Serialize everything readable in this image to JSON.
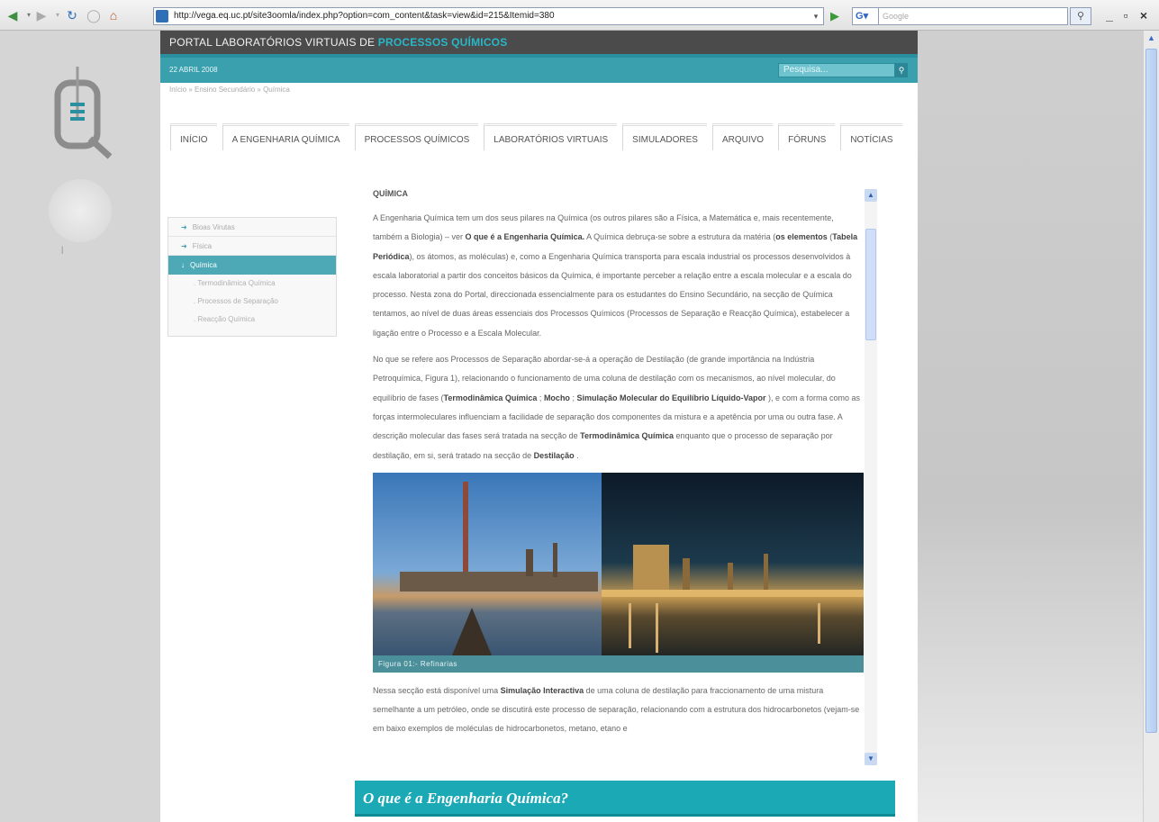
{
  "browser": {
    "url": "http://vega.eq.uc.pt/site3oomla/index.php?option=com_content&task=view&id=215&Itemid=380",
    "search_engine": "G",
    "search_placeholder": "Google"
  },
  "site": {
    "portal_prefix": "PORTAL LABORATÓRIOS VIRTUAIS DE ",
    "portal_accent": "PROCESSOS QUÍMICOS",
    "date": "22 ABRIL 2008",
    "search_placeholder": "Pesquisa...",
    "breadcrumb": "Início » Ensino Secundário » Química",
    "accent_color": "#3aa0ae"
  },
  "menu": [
    {
      "label": "INÍCIO"
    },
    {
      "label": "A ENGENHARIA QUÍMICA"
    },
    {
      "label": "PROCESSOS QUÍMICOS"
    },
    {
      "label": "LABORATÓRIOS VIRTUAIS"
    },
    {
      "label": "SIMULADORES"
    },
    {
      "label": "ARQUIVO"
    },
    {
      "label": "FÓRUNS"
    },
    {
      "label": "NOTÍCIAS"
    }
  ],
  "sidebar": {
    "items": [
      {
        "label": "Bioas Virutas"
      },
      {
        "label": "Física"
      },
      {
        "label": "Química"
      }
    ],
    "subitems": [
      {
        "label": "Termodinâmica Química"
      },
      {
        "label": "Processos de Separação"
      },
      {
        "label": "Reacção Química"
      }
    ]
  },
  "content": {
    "title": "QUÍMICA",
    "p1": {
      "a": "A Engenharia Química tem um dos seus pilares na Química (os outros pilares são a Física, a Matemática e, mais recentemente, também a Biologia) – ver ",
      "b1": "O que é a Engenharia Química.",
      "c": " A Química debruça-se sobre a estrutura da matéria (",
      "b2": "os elementos",
      "d": " (",
      "b3": "Tabela Periódica",
      "e": "), os átomos, as moléculas) e, como a Engenharia Química transporta para escala industrial os processos desenvolvidos à escala laboratorial a partir dos conceitos básicos da Química, é importante perceber a relação entre a escala molecular e a escala do processo. Nesta zona do Portal, direccionada essencialmente para os estudantes do Ensino Secundário, na secção de Química tentamos, ao nível de duas áreas essenciais dos Processos Químicos (Processos de Separação e Reacção Química), estabelecer a ligação entre o Processo e a Escala Molecular."
    },
    "p2": {
      "a": "No que se refere aos Processos de Separação abordar-se-á a operação de Destilação (de grande importância na Indústria Petroquímica, Figura 1), relacionando o funcionamento de uma coluna de destilação com os mecanismos, ao nível molecular, do equilíbrio de fases (",
      "b1": "Termodinâmica Química",
      "c": " ; ",
      "b2": "Mocho",
      "d": " ; ",
      "b3": "Simulação Molecular do Equilíbrio Líquido-Vapor",
      "e": " ), e com a forma como as forças intermoleculares influenciam a facilidade de separação dos componentes da mistura e a apetência por uma ou outra fase. A descrição molecular das fases será tratada na secção de ",
      "b4": "Termodinâmica Química",
      "f": " enquanto que o processo de separação por destilação, em si, será tratado na secção de ",
      "b5": "Destilação",
      "g": " ."
    },
    "caption": "Figura 01:- Refinarias",
    "p3": {
      "a": "Nessa secção está disponível uma ",
      "b1": "Simulação Interactiva",
      "c": " de uma coluna de destilação para fraccionamento de uma mistura semelhante a um petróleo, onde se discutirá este processo de separação, relacionando com a estrutura dos hidrocarbonetos (vejam-se em baixo exemplos de moléculas de hidrocarbonetos, metano, etano e"
    }
  },
  "banner": {
    "text": "O que é a Engenharia Química?"
  }
}
